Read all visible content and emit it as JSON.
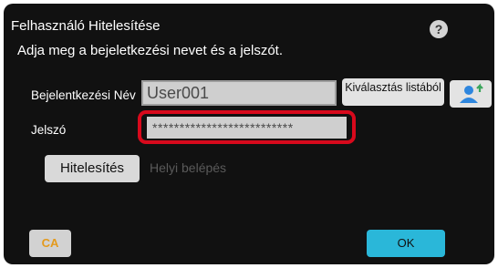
{
  "dialog": {
    "title": "Felhasználó Hitelesítése",
    "help_icon": "question-mark-icon",
    "help_symbol": "?",
    "instruction": "Adja meg a bejeletkezési nevet és a jelszót."
  },
  "form": {
    "username_label": "Bejelentkezési Név",
    "username_value": "User001",
    "select_from_list_label": "Kiválasztás listából",
    "user_icon": "user-add-icon",
    "password_label": "Jelszó",
    "password_value": "**************************"
  },
  "actions": {
    "authenticate_label": "Hitelesítés",
    "local_login_label": "Helyi belépés",
    "ca_label": "CA",
    "ok_label": "OK"
  },
  "colors": {
    "accent_ok": "#2ab7d9",
    "highlight": "#d8091c",
    "user_icon_person": "#2e86de",
    "user_icon_arrow": "#3ba55c",
    "ca_text": "#e49a1c"
  }
}
